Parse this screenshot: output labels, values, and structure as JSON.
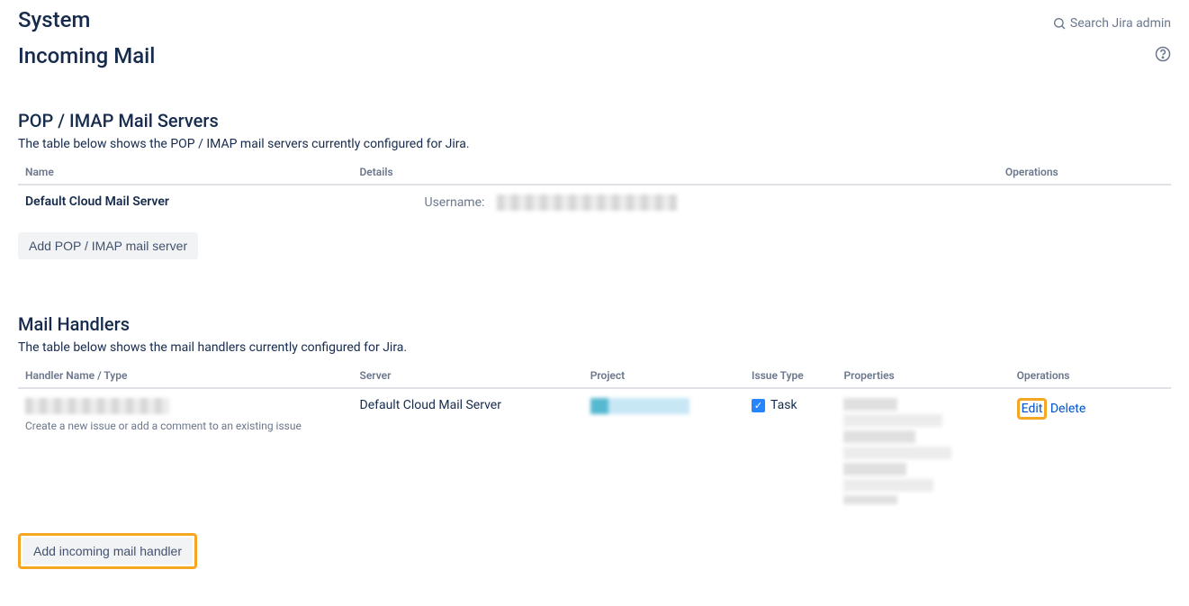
{
  "header": {
    "system_label": "System",
    "search_label": "Search Jira admin"
  },
  "page": {
    "title": "Incoming Mail"
  },
  "servers": {
    "title": "POP / IMAP Mail Servers",
    "desc": "The table below shows the POP / IMAP mail servers currently configured for Jira.",
    "columns": {
      "name": "Name",
      "details": "Details",
      "operations": "Operations"
    },
    "rows": [
      {
        "name": "Default Cloud Mail Server",
        "username_label": "Username:"
      }
    ],
    "add_button": "Add POP / IMAP mail server"
  },
  "handlers": {
    "title": "Mail Handlers",
    "desc": "The table below shows the mail handlers currently configured for Jira.",
    "columns": {
      "name": "Handler Name / Type",
      "server": "Server",
      "project": "Project",
      "issue_type": "Issue Type",
      "properties": "Properties",
      "operations": "Operations"
    },
    "rows": [
      {
        "type_desc": "Create a new issue or add a comment to an existing issue",
        "server": "Default Cloud Mail Server",
        "issue_type": "Task",
        "edit": "Edit",
        "delete": "Delete"
      }
    ],
    "add_button": "Add incoming mail handler"
  }
}
